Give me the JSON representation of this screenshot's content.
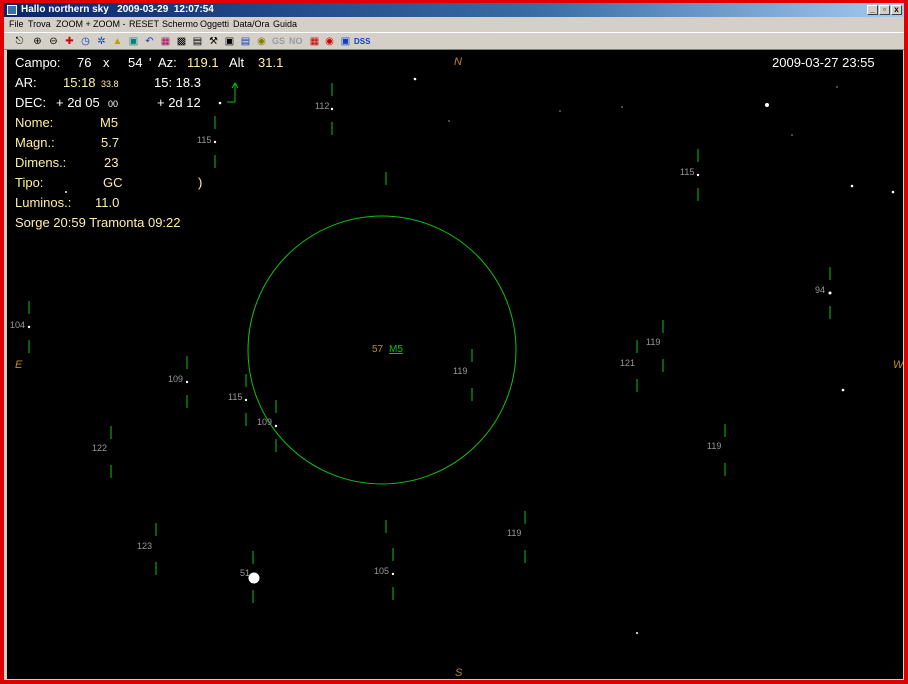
{
  "window": {
    "title": "Hallo northern sky   2009-03-29  12:07:54",
    "controls": {
      "minimize": "_",
      "restore": "▫",
      "close": "x"
    }
  },
  "menu": [
    "File",
    "Trova",
    "ZOOM +",
    "ZOOM -",
    "RESET",
    "Schermo",
    "Oggetti",
    "Data/Ora",
    "Guida"
  ],
  "toolbar": {
    "icons": [
      "binoculars-icon",
      "zoom-in-icon",
      "zoom-out-icon",
      "cross-icon",
      "clock-icon",
      "runner-icon",
      "bell-icon",
      "telescope-icon",
      "undo-icon",
      "book-icon",
      "save-icon",
      "print-icon",
      "tools-icon",
      "photo-icon",
      "calendar-icon",
      "globe-icon"
    ],
    "gs_label": "GS",
    "no_label": "NO",
    "extra_icons": [
      "grid-icon",
      "palette-icon",
      "camera-icon"
    ],
    "dss_label": "DSS"
  },
  "sky": {
    "field_label": "Campo:",
    "field_w": "76",
    "field_x": "x",
    "field_h": "54",
    "field_unit": "'",
    "az_label": "Az:",
    "az_value": "119.1",
    "alt_label": "Alt",
    "alt_value": "31.1",
    "datetime": "2009-03-27   23:55",
    "ra_label": "AR:",
    "ra_value": "15:18",
    "ra_sec": "33.8",
    "ra_alt": "15: 18.3",
    "dec_label": "DEC:",
    "dec_value": "+ 2d 05",
    "dec_sec": "00",
    "dec_alt": "+ 2d 12",
    "name_label": "Nome:",
    "name_value": "M5",
    "mag_label": "Magn.:",
    "mag_value": "5.7",
    "dim_label": "Dimens.:",
    "dim_value": "23",
    "type_label": "Tipo:",
    "type_value": "GC",
    "type_extra": ")",
    "lum_label": "Luminos.:",
    "lum_value": "11.0",
    "rise_set": "Sorge 20:59  Tramonta 09:22",
    "compass": {
      "n": "N",
      "s": "S",
      "e": "E",
      "w": "W"
    },
    "target_mag": "57",
    "target_name": "M5",
    "star_labels": [
      "112",
      "115",
      "115",
      "94",
      "104",
      "109",
      "115",
      "109",
      "119",
      "121",
      "119",
      "122",
      "119",
      "123",
      "51",
      "105",
      "119"
    ]
  },
  "colors": {
    "title_start": "#0a246a",
    "sky": "#000000",
    "info": "#fff0a0",
    "circle": "#10c010",
    "compass": "#c08a28",
    "frame": "#e00000"
  }
}
